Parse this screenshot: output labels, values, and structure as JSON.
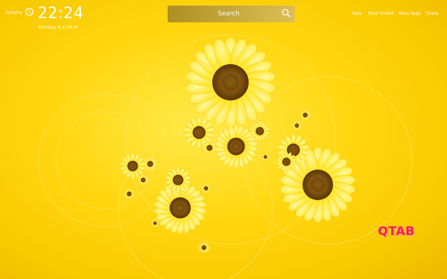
{
  "header": {
    "options_label": "Options",
    "time": "22:24",
    "date": "Monday  4.2.2019"
  },
  "search": {
    "placeholder": "Search"
  },
  "nav": {
    "rate": "Rate",
    "most_visited": "Most Visited",
    "more_apps": "More Apps",
    "share": "Share"
  },
  "brand": {
    "logo_text": "QTAB",
    "logo_color": "#ff1a52"
  },
  "theme": {
    "background": "#ffd60e",
    "petal": "#ffe400",
    "seed": "#8a5a10"
  }
}
